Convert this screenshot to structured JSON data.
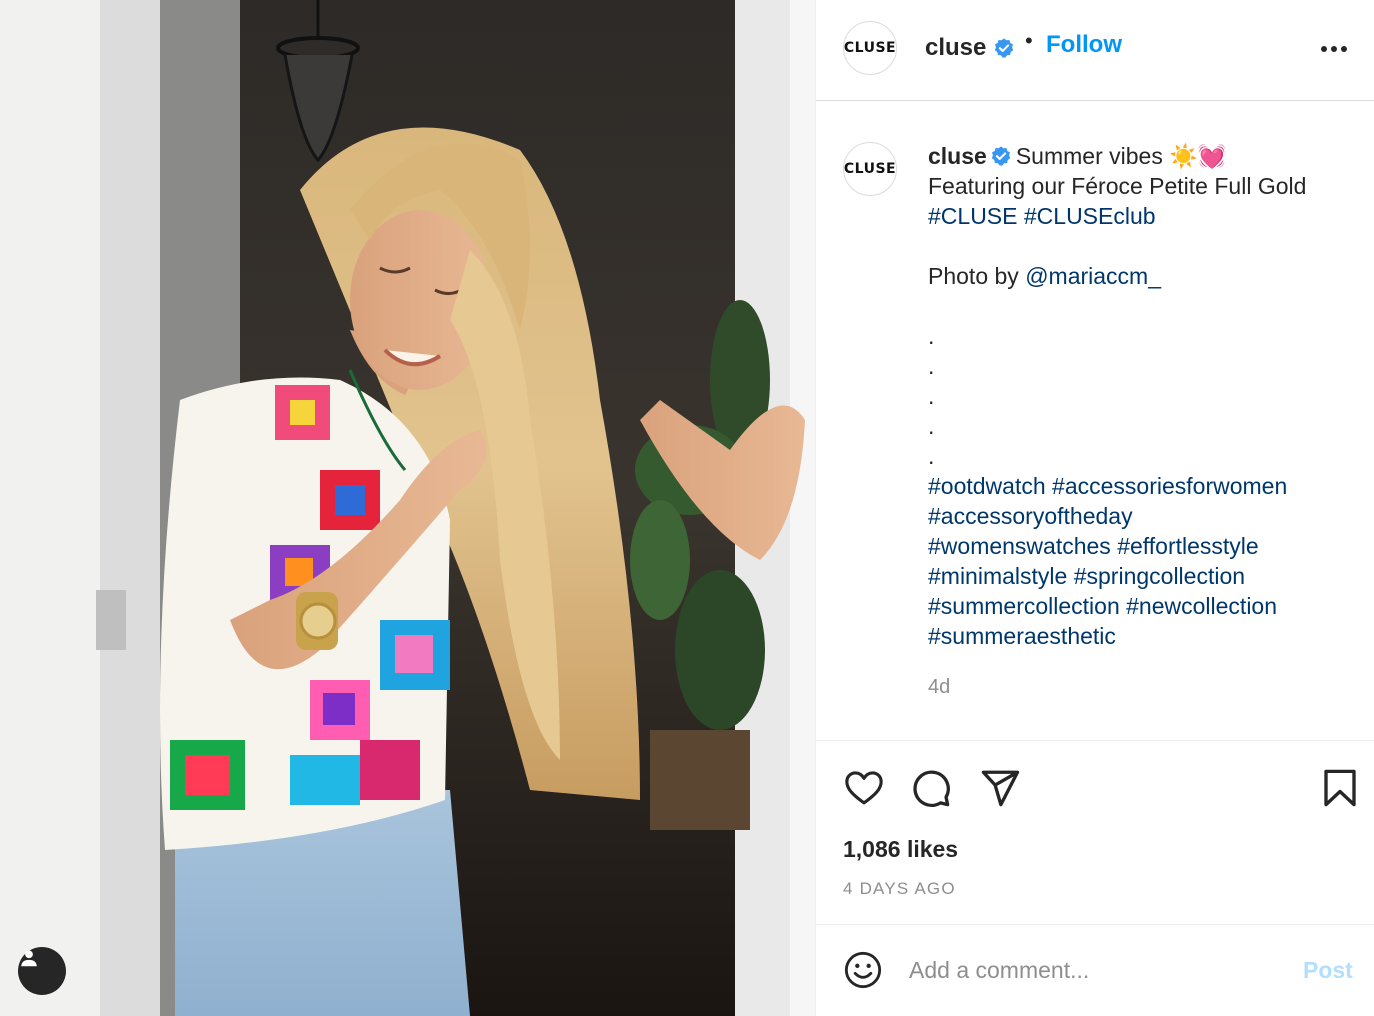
{
  "post": {
    "image_alt": "Woman in a colorful crochet vest and jeans wearing a gold watch, standing in a doorway",
    "tag_icon": "user-icon"
  },
  "header": {
    "avatar_text": "CLUSE",
    "username": "cluse",
    "verified_icon": "verified-badge-icon",
    "separator": "•",
    "follow_label": "Follow",
    "more_icon": "more-options-icon"
  },
  "caption": {
    "avatar_text": "CLUSE",
    "username": "cluse",
    "line1_text": "Summer vibes ☀️💓",
    "line2": "Featuring our Féroce Petite Full Gold",
    "hashtag1": "#CLUSE",
    "hashtag2": "#CLUSEclub",
    "photo_by_prefix": "Photo by ",
    "photo_by_handle": "@mariaccm_",
    "dots": [
      ".",
      ".",
      ".",
      ".",
      "."
    ],
    "hashtags": [
      "#ootdwatch",
      "#accessoriesforwomen",
      "#accessoryoftheday",
      "#womenswatches",
      "#effortlesstyle",
      "#minimalstyle",
      "#springcollection",
      "#summercollection",
      "#newcollection",
      "#summeraesthetic"
    ],
    "age": "4d"
  },
  "actions": {
    "like_icon": "heart-icon",
    "comment_icon": "comment-icon",
    "share_icon": "share-icon",
    "save_icon": "bookmark-icon",
    "likes": "1,086 likes",
    "date": "4 DAYS AGO"
  },
  "comment": {
    "emoji_icon": "emoji-icon",
    "placeholder": "Add a comment...",
    "post_label": "Post"
  },
  "colors": {
    "link": "#00376b",
    "follow": "#0095f6",
    "post_disabled": "#b2dffc",
    "secondary_text": "#8e8e8e"
  }
}
